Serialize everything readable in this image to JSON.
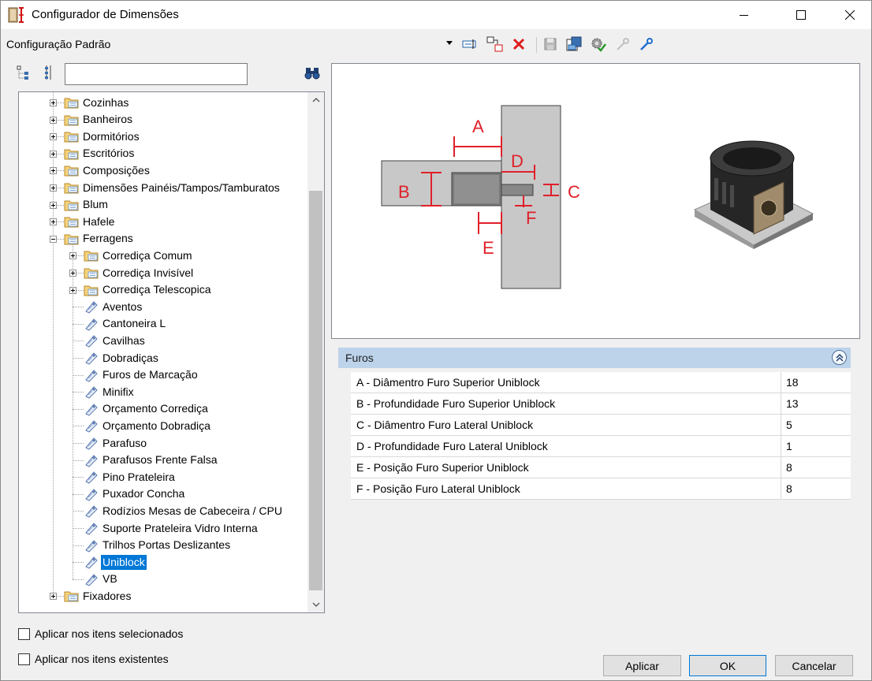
{
  "window": {
    "title": "Configurador de Dimensões",
    "controls": [
      "minimize",
      "maximize",
      "close"
    ]
  },
  "toolbar": {
    "configuration_label": "Configuração Padrão",
    "icons": [
      "rename-icon",
      "copy-config-icon",
      "delete-icon",
      "save-icon",
      "import-icon",
      "settings-icon",
      "key-disabled-icon",
      "key-icon"
    ]
  },
  "tree_tools": {
    "search_value": "",
    "icons": [
      "expand-tree-icon",
      "collapse-tree-icon",
      "binoculars-icon"
    ]
  },
  "tree": {
    "items": [
      {
        "label": "Cozinhas",
        "level": 1,
        "type": "folder",
        "expander": "plus"
      },
      {
        "label": "Banheiros",
        "level": 1,
        "type": "folder",
        "expander": "plus"
      },
      {
        "label": "Dormitórios",
        "level": 1,
        "type": "folder",
        "expander": "plus"
      },
      {
        "label": "Escritórios",
        "level": 1,
        "type": "folder",
        "expander": "plus"
      },
      {
        "label": "Composições",
        "level": 1,
        "type": "folder",
        "expander": "plus"
      },
      {
        "label": "Dimensões Painéis/Tampos/Tamburatos",
        "level": 1,
        "type": "folder",
        "expander": "plus"
      },
      {
        "label": "Blum",
        "level": 1,
        "type": "folder",
        "expander": "plus"
      },
      {
        "label": "Hafele",
        "level": 1,
        "type": "folder",
        "expander": "plus"
      },
      {
        "label": "Ferragens",
        "level": 1,
        "type": "folder",
        "expander": "minus"
      },
      {
        "label": "Corrediça Comum",
        "level": 2,
        "type": "folder",
        "expander": "plus"
      },
      {
        "label": "Corrediça Invisível",
        "level": 2,
        "type": "folder",
        "expander": "plus"
      },
      {
        "label": "Corrediça Telescopica",
        "level": 2,
        "type": "folder",
        "expander": "plus"
      },
      {
        "label": "Aventos",
        "level": 2,
        "type": "item"
      },
      {
        "label": "Cantoneira L",
        "level": 2,
        "type": "item"
      },
      {
        "label": "Cavilhas",
        "level": 2,
        "type": "item"
      },
      {
        "label": "Dobradiças",
        "level": 2,
        "type": "item"
      },
      {
        "label": "Furos de Marcação",
        "level": 2,
        "type": "item"
      },
      {
        "label": "Minifix",
        "level": 2,
        "type": "item"
      },
      {
        "label": "Orçamento Corrediça",
        "level": 2,
        "type": "item"
      },
      {
        "label": "Orçamento Dobradiça",
        "level": 2,
        "type": "item"
      },
      {
        "label": "Parafuso",
        "level": 2,
        "type": "item"
      },
      {
        "label": "Parafusos Frente Falsa",
        "level": 2,
        "type": "item"
      },
      {
        "label": "Pino Prateleira",
        "level": 2,
        "type": "item"
      },
      {
        "label": "Puxador Concha",
        "level": 2,
        "type": "item"
      },
      {
        "label": "Rodízios Mesas de Cabeceira / CPU",
        "level": 2,
        "type": "item"
      },
      {
        "label": "Suporte Prateleira Vidro Interna",
        "level": 2,
        "type": "item"
      },
      {
        "label": "Trilhos Portas Deslizantes",
        "level": 2,
        "type": "item"
      },
      {
        "label": "Uniblock",
        "level": 2,
        "type": "item",
        "selected": true
      },
      {
        "label": "VB",
        "level": 2,
        "type": "item"
      },
      {
        "label": "Fixadores",
        "level": 1,
        "type": "folder",
        "expander": "plus"
      }
    ]
  },
  "options": {
    "apply_selected": "Aplicar nos itens selecionados",
    "apply_existing": "Aplicar nos itens existentes"
  },
  "diagram": {
    "labels": [
      "A",
      "B",
      "C",
      "D",
      "E",
      "F"
    ],
    "accent_color": "#e0202a"
  },
  "properties": {
    "group_title": "Furos",
    "rows": [
      {
        "name": "A - Diâmentro Furo Superior Uniblock",
        "value": "18"
      },
      {
        "name": "B - Profundidade Furo Superior Uniblock",
        "value": "13"
      },
      {
        "name": "C - Diâmentro Furo Lateral Uniblock",
        "value": "5"
      },
      {
        "name": "D - Profundidade Furo Lateral Uniblock",
        "value": "1"
      },
      {
        "name": "E - Posição Furo Superior Uniblock",
        "value": "8"
      },
      {
        "name": "F - Posição Furo Lateral Uniblock",
        "value": "8"
      }
    ]
  },
  "buttons": {
    "apply": "Aplicar",
    "ok": "OK",
    "cancel": "Cancelar"
  }
}
